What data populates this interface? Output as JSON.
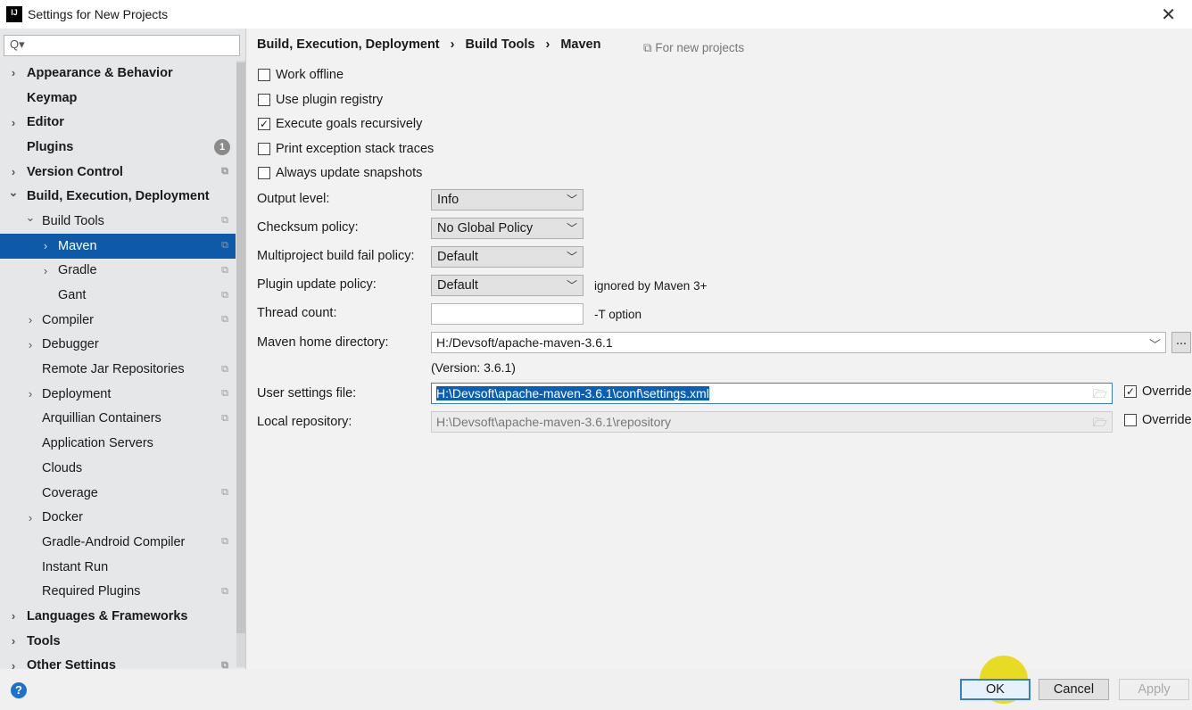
{
  "window": {
    "title": "Settings for New Projects",
    "logo": "IJ"
  },
  "search": {
    "placeholder": "Q▾"
  },
  "tree": [
    {
      "label": "Appearance & Behavior",
      "level": 0,
      "bold": true,
      "arrow": "›"
    },
    {
      "label": "Keymap",
      "level": 0,
      "bold": true
    },
    {
      "label": "Editor",
      "level": 0,
      "bold": true,
      "arrow": "›"
    },
    {
      "label": "Plugins",
      "level": 0,
      "bold": true,
      "badge": "1"
    },
    {
      "label": "Version Control",
      "level": 0,
      "bold": true,
      "arrow": "›",
      "copy": true
    },
    {
      "label": "Build, Execution, Deployment",
      "level": 0,
      "bold": true,
      "arrow": "⌄"
    },
    {
      "label": "Build Tools",
      "level": 1,
      "arrow": "⌄",
      "copy": true
    },
    {
      "label": "Maven",
      "level": 2,
      "arrow": "›",
      "copy": true,
      "selected": true
    },
    {
      "label": "Gradle",
      "level": 2,
      "arrow": "›",
      "copy": true
    },
    {
      "label": "Gant",
      "level": 2,
      "copy": true
    },
    {
      "label": "Compiler",
      "level": 1,
      "arrow": "›",
      "copy": true
    },
    {
      "label": "Debugger",
      "level": 1,
      "arrow": "›"
    },
    {
      "label": "Remote Jar Repositories",
      "level": 1,
      "copy": true
    },
    {
      "label": "Deployment",
      "level": 1,
      "arrow": "›",
      "copy": true
    },
    {
      "label": "Arquillian Containers",
      "level": 1,
      "copy": true
    },
    {
      "label": "Application Servers",
      "level": 1
    },
    {
      "label": "Clouds",
      "level": 1
    },
    {
      "label": "Coverage",
      "level": 1,
      "copy": true
    },
    {
      "label": "Docker",
      "level": 1,
      "arrow": "›"
    },
    {
      "label": "Gradle-Android Compiler",
      "level": 1,
      "copy": true
    },
    {
      "label": "Instant Run",
      "level": 1
    },
    {
      "label": "Required Plugins",
      "level": 1,
      "copy": true
    },
    {
      "label": "Languages & Frameworks",
      "level": 0,
      "bold": true,
      "arrow": "›"
    },
    {
      "label": "Tools",
      "level": 0,
      "bold": true,
      "arrow": "›"
    },
    {
      "label": "Other Settings",
      "level": 0,
      "bold": true,
      "arrow": "›",
      "copy": true
    }
  ],
  "breadcrumb": [
    "Build, Execution, Deployment",
    "›",
    "Build Tools",
    "›",
    "Maven"
  ],
  "for_new_projects": "For new projects",
  "checkboxes": [
    {
      "label": "Work offline",
      "checked": false
    },
    {
      "label": "Use plugin registry",
      "checked": false
    },
    {
      "label": "Execute goals recursively",
      "checked": true
    },
    {
      "label": "Print exception stack traces",
      "checked": false
    },
    {
      "label": "Always update snapshots",
      "checked": false
    }
  ],
  "fields": {
    "output_level": {
      "label": "Output level:",
      "value": "Info"
    },
    "checksum_policy": {
      "label": "Checksum policy:",
      "value": "No Global Policy"
    },
    "multiproject": {
      "label": "Multiproject build fail policy:",
      "value": "Default"
    },
    "plugin_update": {
      "label": "Plugin update policy:",
      "value": "Default",
      "hint": "ignored by Maven 3+"
    },
    "thread_count": {
      "label": "Thread count:",
      "value": "",
      "hint": "-T option"
    },
    "maven_home": {
      "label": "Maven home directory:",
      "value": "H:/Devsoft/apache-maven-3.6.1",
      "version": "(Version: 3.6.1)",
      "browse": "..."
    },
    "user_settings": {
      "label": "User settings file:",
      "value": "H:\\Devsoft\\apache-maven-3.6.1\\conf\\settings.xml",
      "override_label": "Override",
      "override": true
    },
    "local_repo": {
      "label": "Local repository:",
      "value": "H:\\Devsoft\\apache-maven-3.6.1\\repository",
      "override_label": "Override",
      "override": false
    }
  },
  "footer": {
    "help": "?",
    "ok": "OK",
    "cancel": "Cancel",
    "apply": "Apply"
  },
  "colors": {
    "selection": "#0e5aa8",
    "text_selection": "#0a5fb4",
    "accent_focus": "#3c7fc1"
  }
}
